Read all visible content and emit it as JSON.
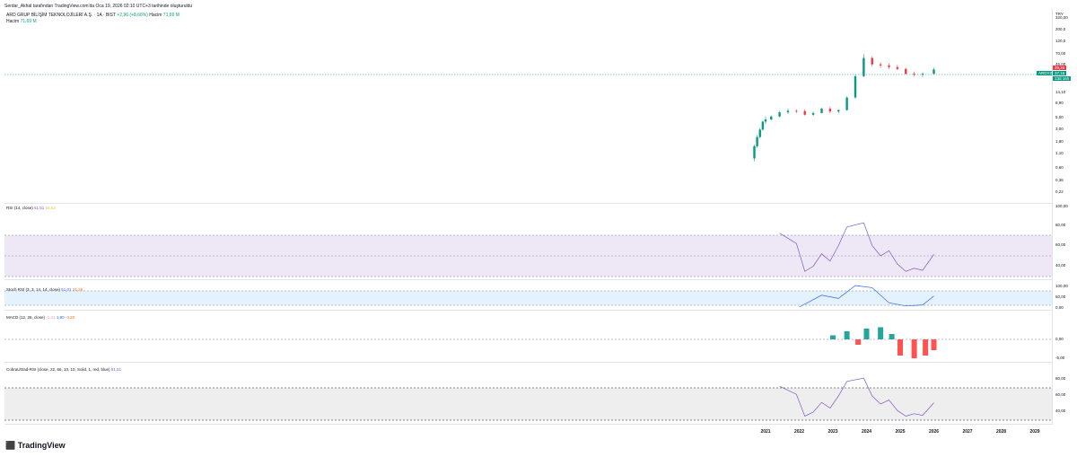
{
  "header": {
    "published": "Serdar_Akhal tarafından TradingView.com'da Oca 19, 2026 02:10 UTC+3 tarihinde oluşturuldu",
    "symbol": "ARD GRUP BİLİŞİM TEKNOLOJİLERİ A.Ş. · 1A · BIST",
    "change": "+2,96 (+8,66%)",
    "volume_label": "Hacim",
    "volume_value": "71,69 M",
    "hacim_row_label": "Hacim",
    "hacim_row_value": "71,69 M"
  },
  "price_axis": {
    "currency": "TRY",
    "labels": [
      "320,00",
      "200,0",
      "120,0",
      "70,00",
      "45,00",
      "14,10",
      "8,90",
      "5,00",
      "3,00",
      "1,80",
      "1,10",
      "0,60",
      "0,36",
      "0,22"
    ],
    "tag_symbol": "ARDYZ",
    "tag_price": "37,16",
    "tag_red": "39,20",
    "tag_time": "13d 16h"
  },
  "rsi": {
    "title": "RSI (14, close)",
    "v1": "61,51",
    "v2": "54,63",
    "axis": [
      "100,00",
      "80,00",
      "60,00",
      "40,00"
    ]
  },
  "stoch": {
    "title": "Stoch RSI (3, 3, 14, 14, close)",
    "v1": "51,01",
    "v2": "31,26",
    "axis": [
      "100,00",
      "50,00",
      "0,00"
    ]
  },
  "macd": {
    "title": "MACD (12, 26, close)",
    "v1": "-1,41",
    "v2": "1,80",
    "v3": "-3,20",
    "axis": [
      "0,00",
      "-5,00"
    ]
  },
  "cyclic": {
    "title": "CobraUltrad-RSI (close, 22, 66, 10, 10, Solid, 1, red, blue)",
    "v1": "61,51",
    "axis": [
      "80,00",
      "60,00",
      "40,00"
    ]
  },
  "x_axis": [
    "2021",
    "2022",
    "2023",
    "2024",
    "2025",
    "2026",
    "2027",
    "2028",
    "2029"
  ],
  "brand": "TradingView",
  "colors": {
    "up": "#089981",
    "down": "#f23645",
    "rsi": "#7e57c2",
    "signal": "#ffeb3b",
    "band": "#ede7f6"
  },
  "chart_data": {
    "type": "candlestick",
    "scale": "log",
    "x_range": [
      "2021",
      "2029"
    ],
    "candles": [
      {
        "t": "2020-09",
        "o": 0.9,
        "h": 1.6,
        "l": 0.8,
        "c": 1.5
      },
      {
        "t": "2020-10",
        "o": 1.5,
        "h": 2.4,
        "l": 1.4,
        "c": 2.2
      },
      {
        "t": "2020-11",
        "o": 2.2,
        "h": 3.2,
        "l": 2.1,
        "c": 3.0
      },
      {
        "t": "2020-12",
        "o": 3.0,
        "h": 4.4,
        "l": 2.9,
        "c": 4.2
      },
      {
        "t": "2021-01",
        "o": 4.2,
        "h": 5.2,
        "l": 3.8,
        "c": 4.6
      },
      {
        "t": "2021-03",
        "o": 4.6,
        "h": 5.4,
        "l": 4.4,
        "c": 5.2
      },
      {
        "t": "2021-06",
        "o": 5.2,
        "h": 6.6,
        "l": 5.0,
        "c": 6.2
      },
      {
        "t": "2021-09",
        "o": 6.2,
        "h": 7.2,
        "l": 5.8,
        "c": 6.6
      },
      {
        "t": "2021-12",
        "o": 6.6,
        "h": 7.0,
        "l": 6.0,
        "c": 6.5
      },
      {
        "t": "2022-03",
        "o": 6.5,
        "h": 7.0,
        "l": 5.4,
        "c": 5.6
      },
      {
        "t": "2022-06",
        "o": 5.6,
        "h": 6.4,
        "l": 5.3,
        "c": 6.0
      },
      {
        "t": "2022-09",
        "o": 6.0,
        "h": 7.6,
        "l": 5.9,
        "c": 7.2
      },
      {
        "t": "2022-12",
        "o": 7.2,
        "h": 7.8,
        "l": 6.0,
        "c": 6.4
      },
      {
        "t": "2023-03",
        "o": 6.4,
        "h": 7.0,
        "l": 6.0,
        "c": 6.8
      },
      {
        "t": "2023-06",
        "o": 6.8,
        "h": 12.0,
        "l": 6.6,
        "c": 11.5
      },
      {
        "t": "2023-09",
        "o": 11.5,
        "h": 30.0,
        "l": 11.0,
        "c": 28.0
      },
      {
        "t": "2023-12",
        "o": 28.0,
        "h": 70.0,
        "l": 27.0,
        "c": 60.0
      },
      {
        "t": "2024-03",
        "o": 60.0,
        "h": 64.0,
        "l": 42.0,
        "c": 46.0
      },
      {
        "t": "2024-06",
        "o": 46.0,
        "h": 50.0,
        "l": 40.0,
        "c": 44.0
      },
      {
        "t": "2024-09",
        "o": 44.0,
        "h": 48.0,
        "l": 38.0,
        "c": 41.0
      },
      {
        "t": "2024-12",
        "o": 41.0,
        "h": 45.0,
        "l": 36.0,
        "c": 38.0
      },
      {
        "t": "2025-03",
        "o": 38.0,
        "h": 40.0,
        "l": 30.0,
        "c": 31.0
      },
      {
        "t": "2025-06",
        "o": 31.0,
        "h": 34.0,
        "l": 28.0,
        "c": 30.0
      },
      {
        "t": "2025-09",
        "o": 30.0,
        "h": 33.0,
        "l": 27.0,
        "c": 31.0
      },
      {
        "t": "2026-01",
        "o": 31.0,
        "h": 40.0,
        "l": 30.0,
        "c": 37.2
      }
    ],
    "rsi": [
      {
        "t": "2021-06",
        "v": 82
      },
      {
        "t": "2021-12",
        "v": 72
      },
      {
        "t": "2022-03",
        "v": 45
      },
      {
        "t": "2022-06",
        "v": 50
      },
      {
        "t": "2022-09",
        "v": 62
      },
      {
        "t": "2022-12",
        "v": 55
      },
      {
        "t": "2023-03",
        "v": 70
      },
      {
        "t": "2023-06",
        "v": 88
      },
      {
        "t": "2023-12",
        "v": 92
      },
      {
        "t": "2024-03",
        "v": 70
      },
      {
        "t": "2024-06",
        "v": 60
      },
      {
        "t": "2024-09",
        "v": 65
      },
      {
        "t": "2024-12",
        "v": 52
      },
      {
        "t": "2025-03",
        "v": 45
      },
      {
        "t": "2025-06",
        "v": 48
      },
      {
        "t": "2025-09",
        "v": 46
      },
      {
        "t": "2026-01",
        "v": 61.51
      }
    ],
    "stoch": [
      {
        "t": "2022-01",
        "v": 0
      },
      {
        "t": "2022-09",
        "v": 55
      },
      {
        "t": "2023-03",
        "v": 40
      },
      {
        "t": "2023-09",
        "v": 100
      },
      {
        "t": "2024-03",
        "v": 90
      },
      {
        "t": "2024-09",
        "v": 20
      },
      {
        "t": "2025-03",
        "v": 5
      },
      {
        "t": "2025-09",
        "v": 10
      },
      {
        "t": "2026-01",
        "v": 51.01
      }
    ],
    "macd_hist": [
      {
        "t": "2023-01",
        "v": 1.5
      },
      {
        "t": "2023-06",
        "v": 3.0
      },
      {
        "t": "2023-10",
        "v": -2.0
      },
      {
        "t": "2024-01",
        "v": 4.0
      },
      {
        "t": "2024-06",
        "v": 4.5
      },
      {
        "t": "2024-10",
        "v": 2.0
      },
      {
        "t": "2025-01",
        "v": -6.0
      },
      {
        "t": "2025-06",
        "v": -7.0
      },
      {
        "t": "2025-10",
        "v": -6.0
      },
      {
        "t": "2026-01",
        "v": -4.0
      }
    ]
  }
}
